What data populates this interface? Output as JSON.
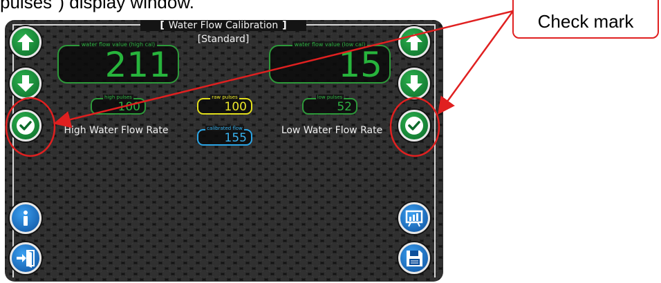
{
  "caption": "pulses\") display window.",
  "screen": {
    "title": "Water Flow Calibration",
    "title_bracket_left": "[",
    "title_bracket_right": "]",
    "subtitle": "[Standard]"
  },
  "high_display": {
    "label": "water flow value (high cal)",
    "value": "211"
  },
  "low_display": {
    "label": "water flow value (low cal)",
    "value": "15"
  },
  "high_pulses": {
    "label": "high pulses",
    "value": "100"
  },
  "raw_pulses": {
    "label": "raw pulses",
    "value": "100"
  },
  "low_pulses": {
    "label": "low pulses",
    "value": "52"
  },
  "calibrated_flow": {
    "label": "calibrated flow",
    "value": "155"
  },
  "high_rate_label": "High Water Flow Rate",
  "low_rate_label": "Low Water Flow Rate",
  "icons": {
    "left_up": "arrow-up-icon",
    "left_down": "arrow-down-icon",
    "left_check": "check-icon",
    "right_up": "arrow-up-icon",
    "right_down": "arrow-down-icon",
    "right_check": "check-icon",
    "info": "info-icon",
    "exit": "exit-door-icon",
    "chart": "chart-board-icon",
    "save": "floppy-disk-icon"
  },
  "callout": {
    "text": "Check mark"
  },
  "colors": {
    "green": "#2fb243",
    "yellow": "#ece82a",
    "blue": "#39b3f0",
    "annotation_red": "#e02020",
    "screen_bg": "#141414"
  }
}
